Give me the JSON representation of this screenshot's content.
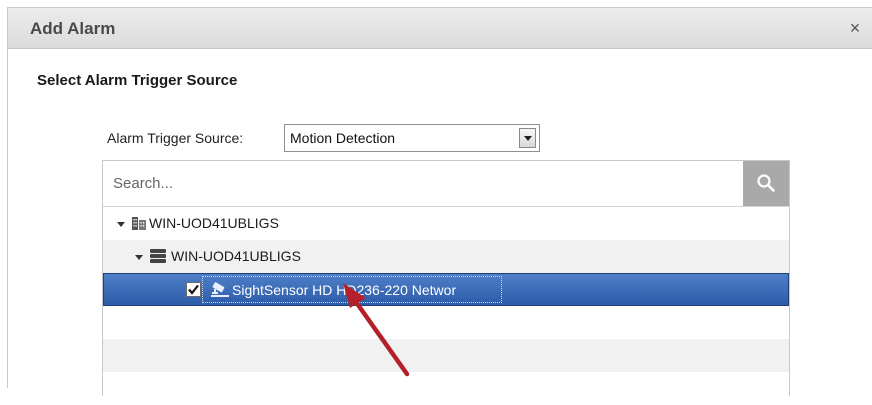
{
  "dialog": {
    "title": "Add Alarm",
    "close_glyph": "×",
    "section_title": "Select Alarm Trigger Source"
  },
  "trigger": {
    "label": "Alarm Trigger Source:",
    "selected_value": "Motion Detection"
  },
  "search": {
    "placeholder": "Search..."
  },
  "tree": {
    "items": [
      {
        "label": "WIN-UOD41UBLIGS",
        "icon": "building-icon",
        "expanded": true
      },
      {
        "label": "WIN-UOD41UBLIGS",
        "icon": "server-icon",
        "expanded": true
      },
      {
        "label": "SightSensor HD HD236-220 Networ",
        "icon": "camera-icon",
        "checked": true,
        "selected": true
      }
    ]
  },
  "colors": {
    "selection": "#2c5ca9",
    "search_button": "#a9a9a9",
    "annotation_arrow": "#b3202a"
  }
}
